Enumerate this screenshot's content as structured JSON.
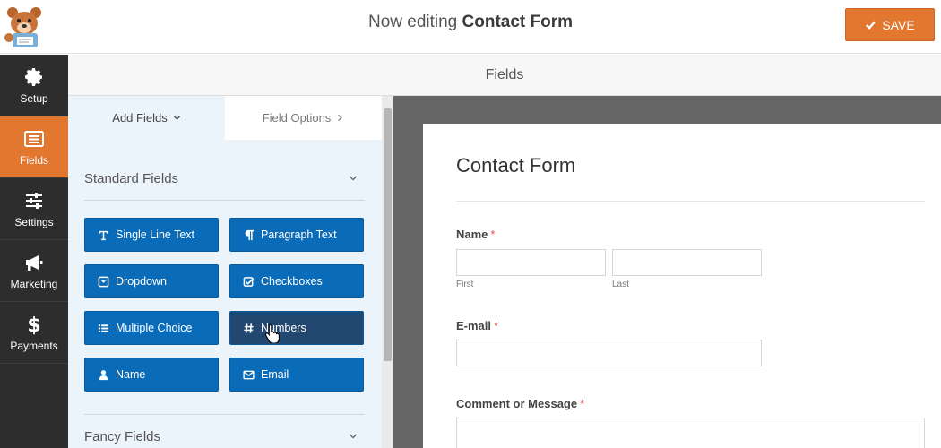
{
  "header": {
    "title_prefix": "Now editing",
    "title_name": "Contact Form",
    "save_label": "SAVE",
    "logo_icon": "wpforms-bear-logo-icon"
  },
  "sidebar": {
    "items": [
      {
        "label": "Setup",
        "icon": "gear-icon",
        "active": false
      },
      {
        "label": "Fields",
        "icon": "list-icon",
        "active": true
      },
      {
        "label": "Settings",
        "icon": "sliders-icon",
        "active": false
      },
      {
        "label": "Marketing",
        "icon": "megaphone-icon",
        "active": false
      },
      {
        "label": "Payments",
        "icon": "dollar-icon",
        "active": false
      }
    ]
  },
  "section_header": "Fields",
  "panel": {
    "tabs": [
      {
        "label": "Add Fields",
        "icon": "chevron-down-icon"
      },
      {
        "label": "Field Options",
        "icon": "chevron-right-icon"
      }
    ],
    "standard_title": "Standard Fields",
    "standard_fields": [
      {
        "label": "Single Line Text",
        "icon": "text-icon"
      },
      {
        "label": "Paragraph Text",
        "icon": "paragraph-icon"
      },
      {
        "label": "Dropdown",
        "icon": "dropdown-icon"
      },
      {
        "label": "Checkboxes",
        "icon": "checkbox-icon"
      },
      {
        "label": "Multiple Choice",
        "icon": "list-bullets-icon"
      },
      {
        "label": "Numbers",
        "icon": "hash-icon"
      },
      {
        "label": "Name",
        "icon": "user-icon"
      },
      {
        "label": "Email",
        "icon": "envelope-icon"
      }
    ],
    "fancy_title": "Fancy Fields"
  },
  "form": {
    "title": "Contact Form",
    "name_label": "Name",
    "first_sublabel": "First",
    "last_sublabel": "Last",
    "email_label": "E-mail",
    "comment_label": "Comment or Message",
    "required_mark": "*"
  },
  "colors": {
    "accent": "#e27730",
    "button_blue": "#0a6cb8",
    "nav_dark": "#2d2d2d"
  }
}
